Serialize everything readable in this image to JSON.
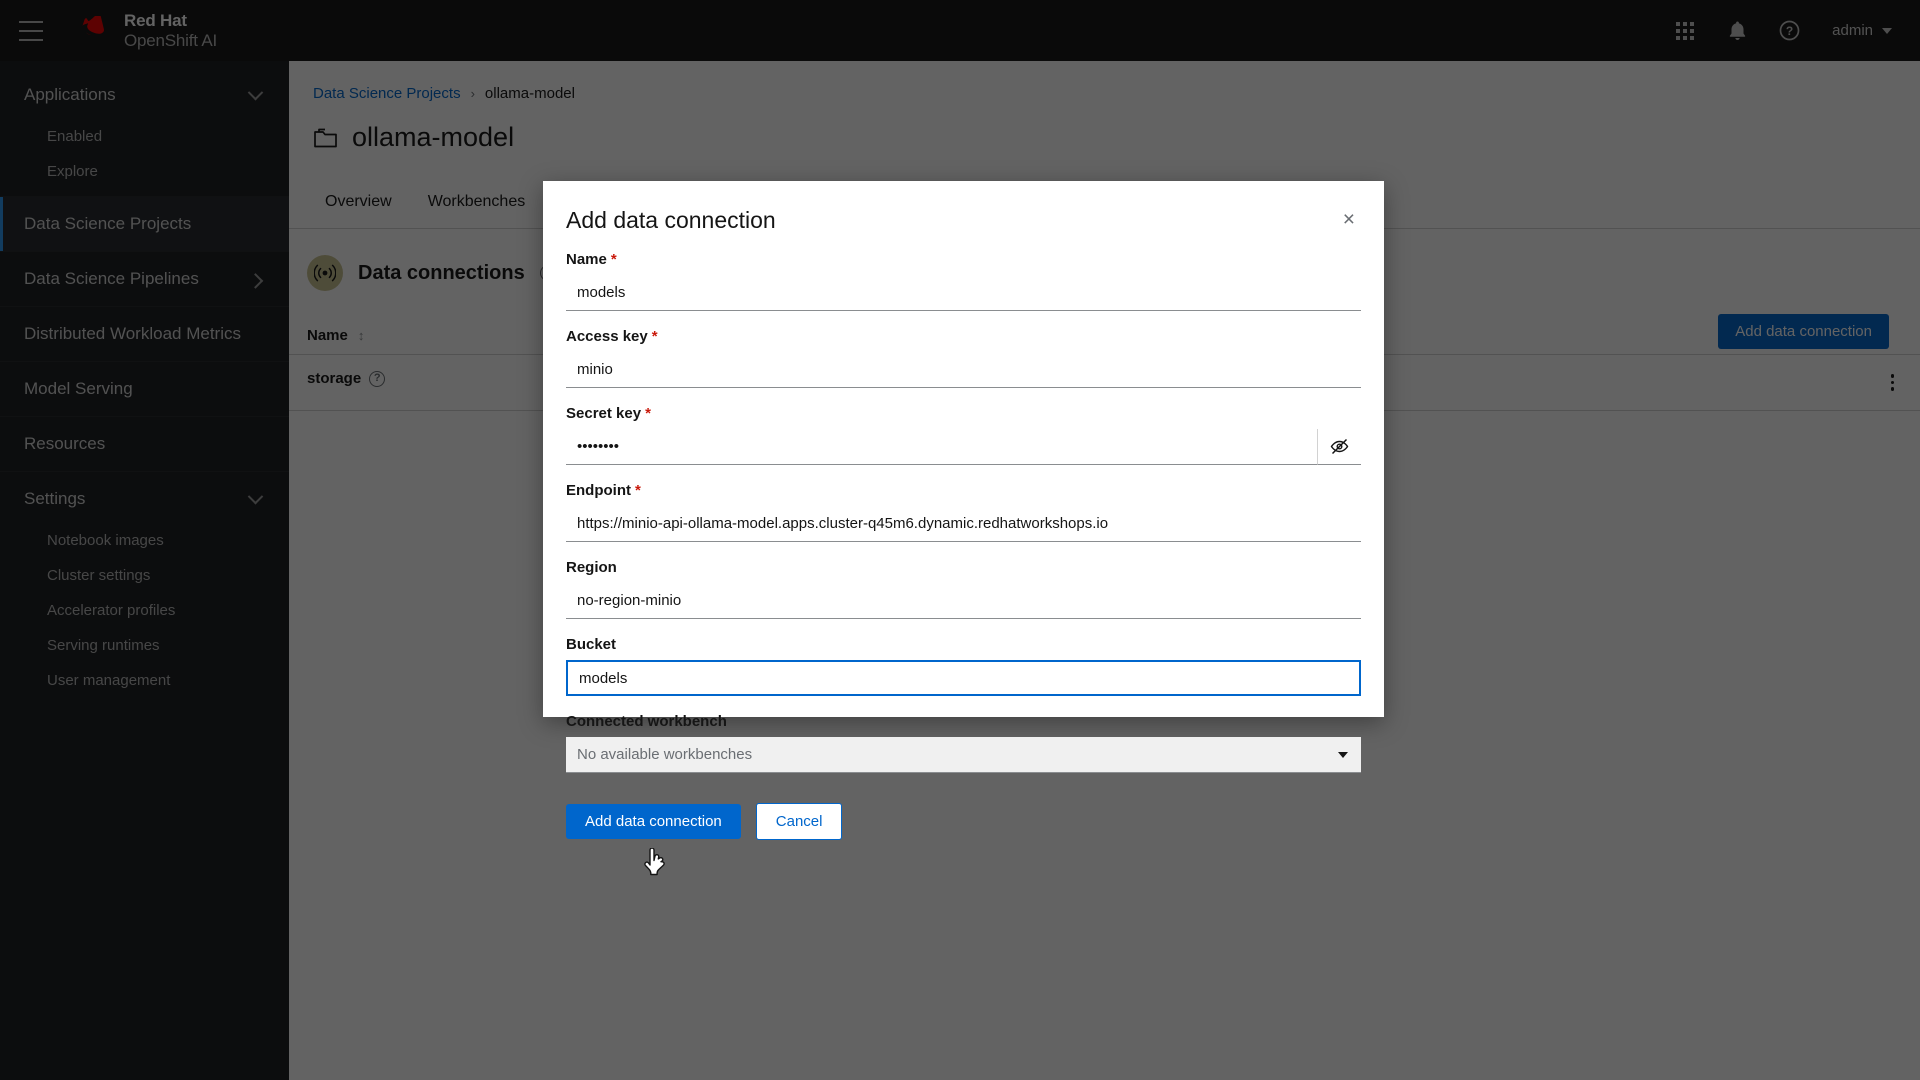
{
  "masthead": {
    "menu_icon": "hamburger-icon",
    "brand_line1": "Red Hat",
    "brand_line2": "OpenShift AI",
    "app_launcher_icon": "grid-icon",
    "notifications_icon": "bell-icon",
    "help_icon": "help-circle-icon",
    "user_name": "admin"
  },
  "sidebar": {
    "groups": [
      {
        "label": "Applications",
        "expanded": true,
        "children": [
          {
            "label": "Enabled"
          },
          {
            "label": "Explore"
          }
        ]
      }
    ],
    "items": [
      {
        "label": "Data Science Projects",
        "active": true,
        "has_arrow": false
      },
      {
        "label": "Data Science Pipelines",
        "active": false,
        "has_arrow": true
      },
      {
        "label": "Distributed Workload Metrics",
        "active": false,
        "has_arrow": false
      },
      {
        "label": "Model Serving",
        "active": false,
        "has_arrow": false
      },
      {
        "label": "Resources",
        "active": false,
        "has_arrow": false
      }
    ],
    "settings_group": {
      "label": "Settings",
      "expanded": true,
      "children": [
        {
          "label": "Notebook images"
        },
        {
          "label": "Cluster settings"
        },
        {
          "label": "Accelerator profiles"
        },
        {
          "label": "Serving runtimes"
        },
        {
          "label": "User management"
        }
      ]
    }
  },
  "page": {
    "breadcrumb": {
      "parent": "Data Science Projects",
      "separator": "›",
      "current": "ollama-model"
    },
    "title": "ollama-model",
    "title_icon": "project-folder-icon",
    "tabs": [
      {
        "label": "Overview"
      },
      {
        "label": "Workbenches"
      }
    ],
    "section": {
      "icon": "broadcast-signal-icon",
      "title": "Data connections",
      "help_icon": "help-circle-icon"
    },
    "add_button_label": "Add data connection",
    "table": {
      "columns": [
        "Name"
      ],
      "sort_icon": "sort-arrows-icon",
      "rows": [
        {
          "name": "storage",
          "help_icon": "help-circle-icon",
          "kebab_icon": "kebab-menu-icon"
        }
      ]
    }
  },
  "modal": {
    "title": "Add data connection",
    "close_icon": "close-x-icon",
    "fields": {
      "name": {
        "label": "Name",
        "required": true,
        "value": "models"
      },
      "access_key": {
        "label": "Access key",
        "required": true,
        "value": "minio"
      },
      "secret_key": {
        "label": "Secret key",
        "required": true,
        "value": "••••••••",
        "reveal_icon": "eye-slash-icon"
      },
      "endpoint": {
        "label": "Endpoint",
        "required": true,
        "value": "https://minio-api-ollama-model.apps.cluster-q45m6.dynamic.redhatworkshops.io"
      },
      "region": {
        "label": "Region",
        "required": false,
        "value": "no-region-minio"
      },
      "bucket": {
        "label": "Bucket",
        "required": false,
        "value": "models",
        "focused": true
      },
      "connected_workbench": {
        "label": "Connected workbench",
        "required": false,
        "value": "No available workbenches",
        "caret_icon": "caret-down-icon"
      }
    },
    "submit_label": "Add data connection",
    "cancel_label": "Cancel"
  },
  "colors": {
    "brand_red": "#ee0000",
    "accent_blue": "#0066cc",
    "masthead_bg": "#151515",
    "sidebar_bg": "#1b1d21",
    "required_red": "#c9190b",
    "section_icon_bg": "#c9c392"
  }
}
